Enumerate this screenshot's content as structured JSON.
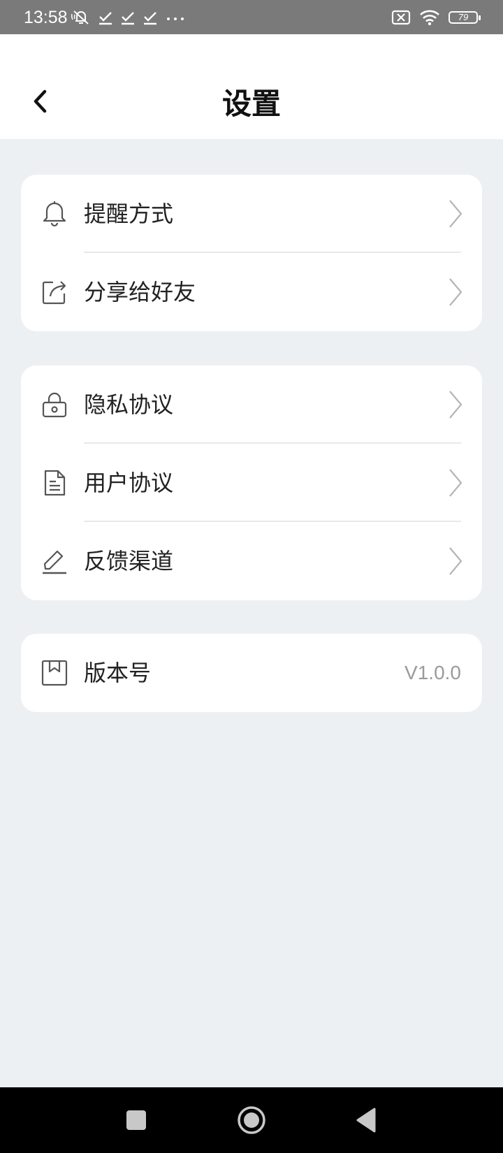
{
  "status_bar": {
    "time": "13:58",
    "battery": "79",
    "left_icons": [
      "mute-icon",
      "check-icon",
      "check-icon",
      "check-icon",
      "more-icon"
    ],
    "right_icons": [
      "no-sim-icon",
      "wifi-icon",
      "battery-icon"
    ]
  },
  "header": {
    "title": "设置",
    "back_icon": "chevron-left-icon"
  },
  "groups": [
    {
      "items": [
        {
          "label": "提醒方式",
          "icon": "bell-icon"
        },
        {
          "label": "分享给好友",
          "icon": "share-icon"
        }
      ]
    },
    {
      "items": [
        {
          "label": "隐私协议",
          "icon": "lock-icon"
        },
        {
          "label": "用户协议",
          "icon": "document-icon"
        },
        {
          "label": "反馈渠道",
          "icon": "edit-icon"
        }
      ]
    },
    {
      "items": [
        {
          "label": "版本号",
          "icon": "bookmark-icon",
          "value": "V1.0.0"
        }
      ]
    }
  ],
  "nav_bar": {
    "buttons": [
      "recents-square-icon",
      "home-circle-icon",
      "back-triangle-icon"
    ]
  },
  "colors": {
    "background": "#edf0f3",
    "card": "#ffffff",
    "status_bar": "#7a7a7a",
    "text": "#222222",
    "value_text": "#9a9a9a",
    "nav_bar": "#000000"
  }
}
